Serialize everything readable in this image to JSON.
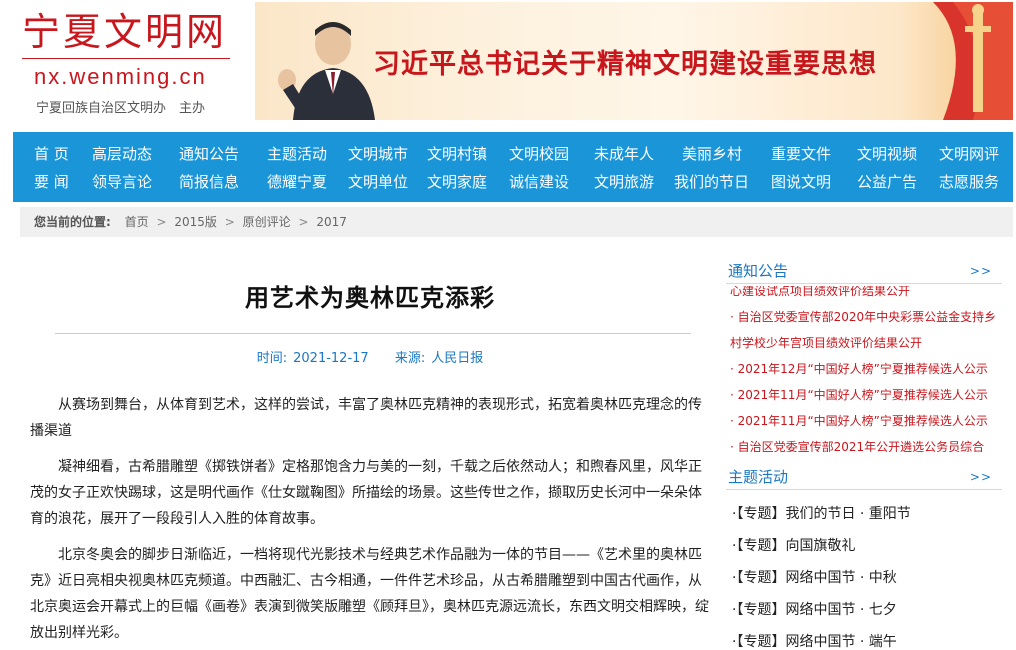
{
  "site": {
    "name": "宁夏文明网",
    "url_text": "nx.wenming.cn",
    "sponsor": "宁夏回族自治区文明办　主办"
  },
  "banner": {
    "title": "习近平总书记关于精神文明建设重要思想"
  },
  "nav": {
    "row1": [
      "首 页",
      "高层动态",
      "通知公告",
      "主题活动",
      "文明城市",
      "文明村镇",
      "文明校园",
      "未成年人",
      "美丽乡村",
      "重要文件",
      "文明视频",
      "文明网评"
    ],
    "row2": [
      "要 闻",
      "领导言论",
      "简报信息",
      "德耀宁夏",
      "文明单位",
      "文明家庭",
      "诚信建设",
      "文明旅游",
      "我们的节日",
      "图说文明",
      "公益广告",
      "志愿服务"
    ]
  },
  "breadcrumb": {
    "lead": "您当前的位置:",
    "items": [
      "首页",
      "2015版",
      "原创评论",
      "2017"
    ],
    "separator": ">"
  },
  "article": {
    "title": "用艺术为奥林匹克添彩",
    "time_label": "时间:",
    "time_value": "2021-12-17",
    "source_label": "来源:",
    "source_value": "人民日报",
    "paragraphs": [
      "从赛场到舞台，从体育到艺术，这样的尝试，丰富了奥林匹克精神的表现形式，拓宽着奥林匹克理念的传播渠道",
      "凝神细看，古希腊雕塑《掷铁饼者》定格那饱含力与美的一刻，千载之后依然动人；和煦春风里，风华正茂的女子正欢快踢球，这是明代画作《仕女蹴鞠图》所描绘的场景。这些传世之作，撷取历史长河中一朵朵体育的浪花，展开了一段段引人入胜的体育故事。",
      "北京冬奥会的脚步日渐临近，一档将现代光影技术与经典艺术作品融为一体的节目——《艺术里的奥林匹克》近日亮相央视奥林匹克频道。中西融汇、古今相通，一件件艺术珍品，从古希腊雕塑到中国古代画作，从北京奥运会开幕式上的巨幅《画卷》表演到微笑版雕塑《顾拜旦》，奥林匹克源远流长，东西文明交相辉映，绽放出别样光彩。"
    ]
  },
  "sidebar": {
    "notice": {
      "title": "通知公告",
      "more": ">>",
      "items": [
        "心建设试点项目绩效评价结果公开",
        "· 自治区党委宣传部2020年中央彩票公益金支持乡村学校少年宫项目绩效评价结果公开",
        "· 2021年12月“中国好人榜”宁夏推荐候选人公示",
        "· 2021年11月“中国好人榜”宁夏推荐候选人公示",
        "· 2021年11月“中国好人榜”宁夏推荐候选人公示",
        "· 自治区党委宣传部2021年公开遴选公务员综合"
      ]
    },
    "topics": {
      "title": "主题活动",
      "more": ">>",
      "items": [
        "·【专题】我们的节日 · 重阳节",
        "·【专题】向国旗敬礼",
        "·【专题】网络中国节 · 中秋",
        "·【专题】网络中国节 · 七夕",
        "·【专题】网络中国节 · 端午"
      ]
    }
  },
  "colors": {
    "brand_red": "#c8161d",
    "nav_blue": "#1a95d8",
    "link_blue": "#1a78c2"
  }
}
